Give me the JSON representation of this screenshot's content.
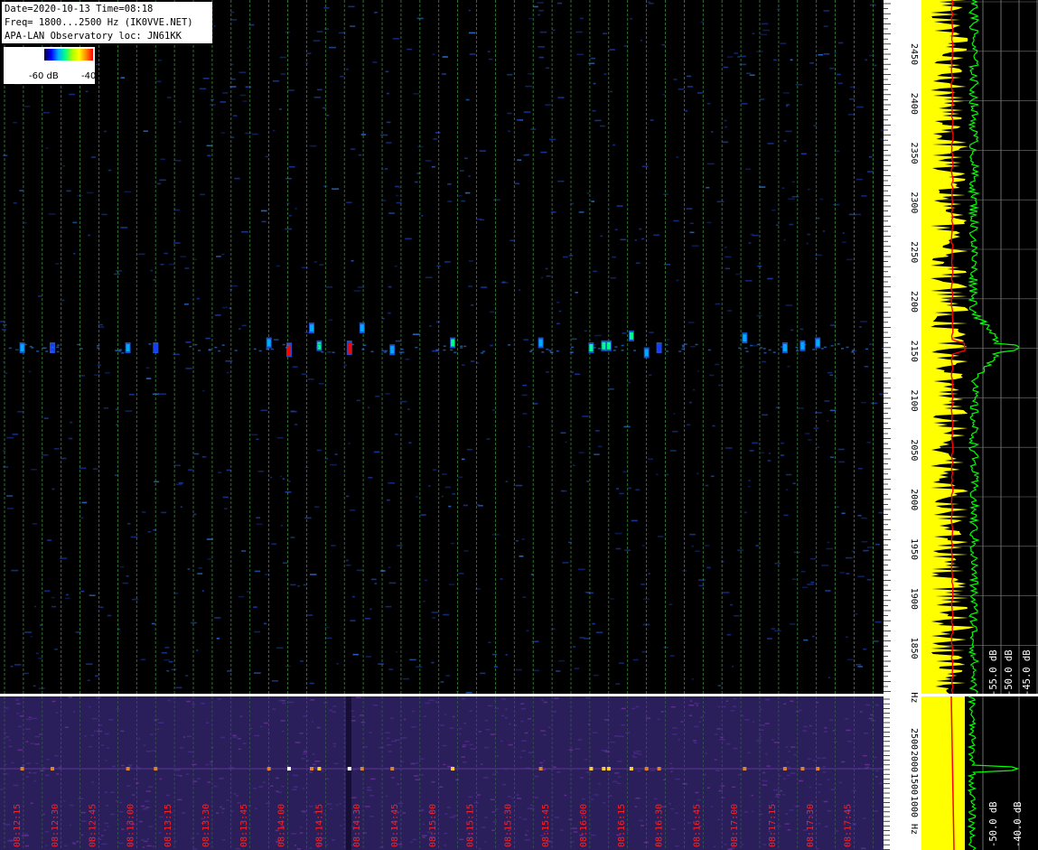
{
  "header": {
    "line1": "Date=2020-10-13 Time=08:18",
    "line2": "Freq= 1800...2500 Hz (IK0VVE.NET)",
    "line3": "APA-LAN Observatory loc: JN61KK"
  },
  "legend": {
    "min_label": "-60 dB",
    "max_label": "-40"
  },
  "colors": {
    "background": "#000000",
    "grid": "#3a8a3a",
    "time_label": "#ff2020",
    "axis_label": "#000000",
    "trace_yellow": "#ffff00",
    "trace_green": "#00ff00",
    "trace_red": "#ff0000",
    "bottom_background": "#2a1f5a"
  },
  "chart_data": [
    {
      "type": "heatmap",
      "name": "spectrogram-top",
      "x_ticks": [
        "08:12:15",
        "08:12:30",
        "08:12:45",
        "08:13:00",
        "08:13:15",
        "08:13:30",
        "08:13:45",
        "08:14:00",
        "08:14:15",
        "08:14:30",
        "08:14:45",
        "08:15:00",
        "08:15:15",
        "08:15:30",
        "08:15:45",
        "08:16:00",
        "08:16:15",
        "08:16:30",
        "08:16:45",
        "08:17:00",
        "08:17:15",
        "08:17:30",
        "08:17:45"
      ],
      "y_ticks": [
        "2450",
        "2400",
        "2350",
        "2300",
        "2250",
        "2200",
        "2150",
        "2100",
        "2050",
        "2000",
        "1950",
        "1900",
        "1850",
        "Hz"
      ],
      "ylim": [
        1800,
        2500
      ],
      "color_scale_db": [
        -60,
        -40
      ],
      "signal_frequency_hz": 2150,
      "detections": [
        {
          "time": "08:12:17",
          "freq": 2150,
          "level_db": -55
        },
        {
          "time": "08:12:29",
          "freq": 2150,
          "level_db": -56
        },
        {
          "time": "08:12:59",
          "freq": 2150,
          "level_db": -53
        },
        {
          "time": "08:13:10",
          "freq": 2150,
          "level_db": -56
        },
        {
          "time": "08:13:55",
          "freq": 2155,
          "level_db": -53
        },
        {
          "time": "08:14:03",
          "freq": 2148,
          "level_db": -40
        },
        {
          "time": "08:14:12",
          "freq": 2170,
          "level_db": -54
        },
        {
          "time": "08:14:15",
          "freq": 2152,
          "level_db": -51
        },
        {
          "time": "08:14:27",
          "freq": 2150,
          "level_db": -40
        },
        {
          "time": "08:14:32",
          "freq": 2170,
          "level_db": -55
        },
        {
          "time": "08:14:44",
          "freq": 2148,
          "level_db": -53
        },
        {
          "time": "08:15:08",
          "freq": 2155,
          "level_db": -51
        },
        {
          "time": "08:15:43",
          "freq": 2155,
          "level_db": -54
        },
        {
          "time": "08:16:03",
          "freq": 2150,
          "level_db": -50
        },
        {
          "time": "08:16:08",
          "freq": 2152,
          "level_db": -51
        },
        {
          "time": "08:16:10",
          "freq": 2152,
          "level_db": -50
        },
        {
          "time": "08:16:19",
          "freq": 2162,
          "level_db": -50
        },
        {
          "time": "08:16:25",
          "freq": 2145,
          "level_db": -53
        },
        {
          "time": "08:16:30",
          "freq": 2150,
          "level_db": -56
        },
        {
          "time": "08:17:04",
          "freq": 2160,
          "level_db": -53
        },
        {
          "time": "08:17:20",
          "freq": 2150,
          "level_db": -53
        },
        {
          "time": "08:17:27",
          "freq": 2152,
          "level_db": -54
        },
        {
          "time": "08:17:33",
          "freq": 2155,
          "level_db": -55
        }
      ]
    },
    {
      "type": "line",
      "name": "spectrum-top",
      "x_ticks": [
        "-55.0 dB",
        "-50.0 dB",
        "-45.0 dB"
      ],
      "series": [
        {
          "color": "#ffff00",
          "peak_hz": 2150
        },
        {
          "color": "#00ff00",
          "peak_hz": 2150,
          "peak_db": -45
        },
        {
          "color": "#ff0000",
          "peak_hz": 2150
        }
      ]
    },
    {
      "type": "heatmap",
      "name": "spectrogram-bottom",
      "y_ticks": [
        "2500",
        "2000",
        "1500",
        "1000",
        "Hz"
      ]
    },
    {
      "type": "line",
      "name": "spectrum-bottom",
      "x_ticks": [
        "-50.0 dB",
        "-40.0 dB"
      ]
    }
  ]
}
